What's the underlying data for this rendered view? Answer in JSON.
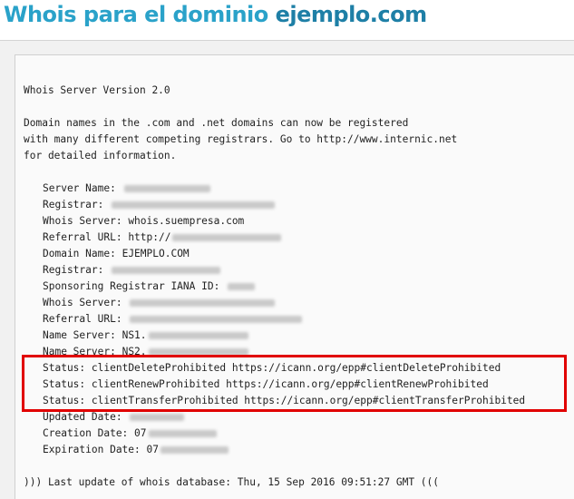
{
  "header": {
    "title_prefix": "Whois para el dominio ",
    "title_domain": "ejemplo.com"
  },
  "whois": {
    "version": "Whois Server Version 2.0",
    "intro": [
      "Domain names in the .com and .net domains can now be registered",
      "with many different competing registrars. Go to http://www.internic.net",
      "for detailed information."
    ],
    "records": [
      {
        "label": "Server Name:",
        "value": "",
        "blur": 95
      },
      {
        "label": "Registrar:",
        "value": "",
        "blur": 180
      },
      {
        "label": "Whois Server:",
        "value": "whois.suempresa.com",
        "blur": 0
      },
      {
        "label": "Referral URL:",
        "value": "http://",
        "blur": 120
      },
      {
        "label": "Domain Name:",
        "value": "EJEMPLO.COM",
        "blur": 0
      },
      {
        "label": "Registrar:",
        "value": "",
        "blur": 120
      },
      {
        "label": "Sponsoring Registrar IANA ID:",
        "value": "",
        "blur": 30
      },
      {
        "label": "Whois Server:",
        "value": "",
        "blur": 160
      },
      {
        "label": "Referral URL:",
        "value": "",
        "blur": 190
      },
      {
        "label": "Name Server:",
        "value": "NS1.",
        "blur": 110
      },
      {
        "label": "Name Server:",
        "value": "NS2.",
        "blur": 110
      },
      {
        "label": "Status:",
        "value": "clientDeleteProhibited https://icann.org/epp#clientDeleteProhibited",
        "blur": 0
      },
      {
        "label": "Status:",
        "value": "clientRenewProhibited https://icann.org/epp#clientRenewProhibited",
        "blur": 0
      },
      {
        "label": "Status:",
        "value": "clientTransferProhibited https://icann.org/epp#clientTransferProhibited",
        "blur": 0
      },
      {
        "label": "Updated Date:",
        "value": "",
        "blur": 60
      },
      {
        "label": "Creation Date:",
        "value": "07",
        "blur": 75
      },
      {
        "label": "Expiration Date:",
        "value": "07",
        "blur": 75
      }
    ],
    "footer": "))) Last update of whois database: Thu, 15 Sep 2016 09:51:27 GMT ((("
  },
  "colors": {
    "title": "#2aa2c9",
    "highlight_border": "#e10000"
  }
}
